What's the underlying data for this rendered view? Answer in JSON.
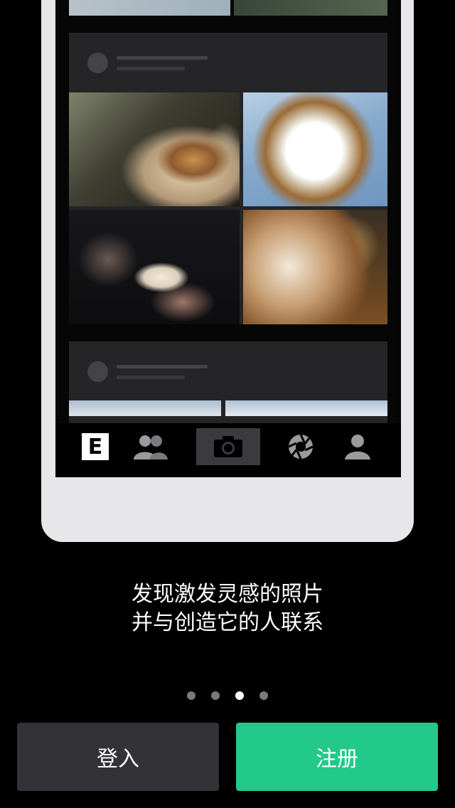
{
  "onboarding": {
    "caption_line1": "发现激发灵感的照片",
    "caption_line2": "并与创造它的人联系",
    "page_count": 4,
    "current_page": 3
  },
  "actions": {
    "login_label": "登入",
    "signup_label": "注册"
  },
  "mock_tabbar": {
    "logo_letter": "E",
    "icons": [
      "logo-e-icon",
      "people-icon",
      "camera-icon",
      "aperture-icon",
      "profile-icon"
    ],
    "active_tab": "camera-icon"
  },
  "colors": {
    "accent_green": "#22c98b",
    "login_button": "#333236",
    "phone_frame": "#e7e6e8"
  }
}
